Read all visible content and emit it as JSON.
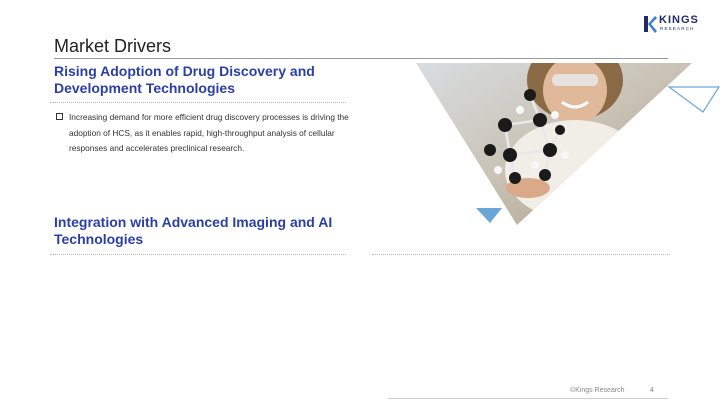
{
  "slide": {
    "title": "Market Drivers",
    "logo": {
      "word": "KINGS",
      "sub": "RESEARCH",
      "colors": {
        "navy": "#1f2a6b",
        "accent": "#3b7fd0"
      }
    },
    "sections": [
      {
        "heading": "Rising Adoption of Drug Discovery and Development Technologies",
        "bullets": [
          "Increasing demand for more efficient drug discovery processes is driving the adoption of HCS, as it enables rapid, high-throughput analysis of cellular responses and accelerates preclinical research."
        ]
      },
      {
        "heading": "Integration with Advanced Imaging and AI Technologies",
        "bullets": []
      }
    ],
    "image": {
      "subject": "scientist-with-molecular-model",
      "accent_color": "#6aa6d6"
    },
    "footer": {
      "copyright": "©Kings Research",
      "page_number": "4"
    },
    "colors": {
      "heading": "#2b3fa6",
      "title": "#222222",
      "body": "#333333"
    }
  }
}
